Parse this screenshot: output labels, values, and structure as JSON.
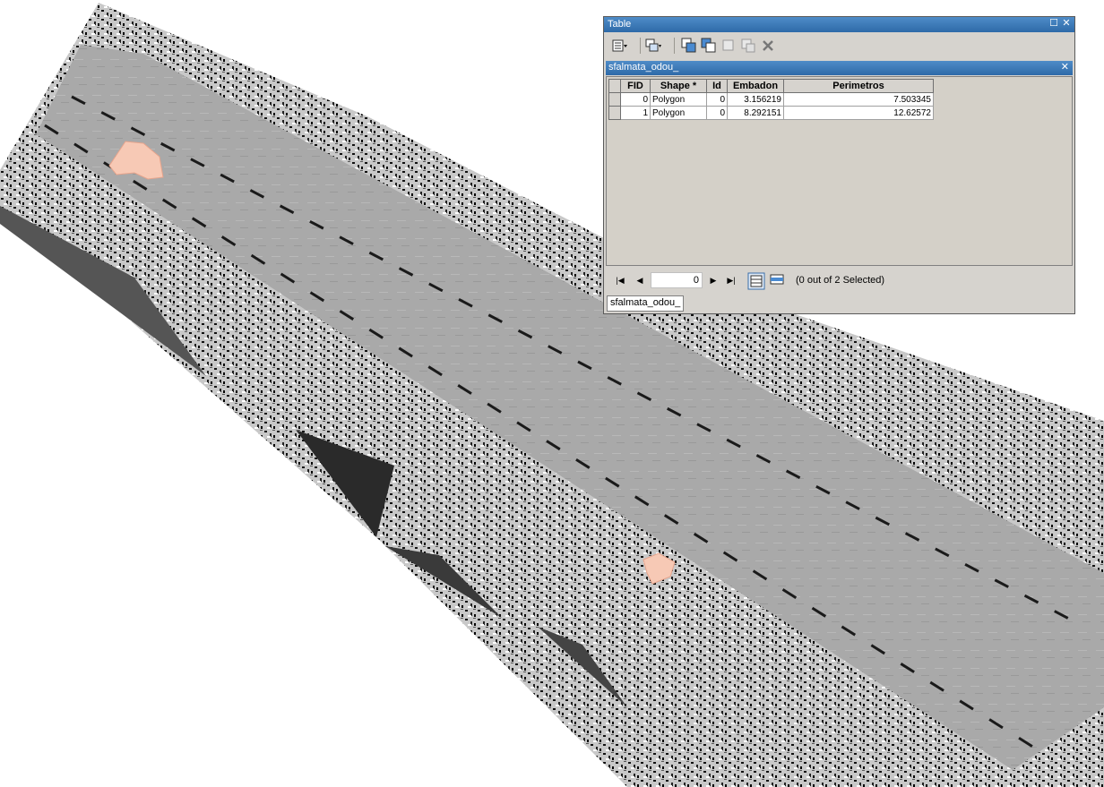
{
  "window": {
    "title": "Table",
    "maximize_icon": "maximize-icon",
    "close_icon": "close-icon"
  },
  "layer": {
    "name": "sfalmata_odou_",
    "tab_label": "sfalmata_odou_"
  },
  "table": {
    "columns": [
      "FID",
      "Shape *",
      "Id",
      "Embadon",
      "Perimetros"
    ],
    "rows": [
      [
        "0",
        "Polygon",
        "0",
        "3.156219",
        "7.503345"
      ],
      [
        "1",
        "Polygon",
        "0",
        "8.292151",
        "12.62572"
      ]
    ]
  },
  "navigation": {
    "current_record": "0",
    "selection_status": "(0 out of 2 Selected)"
  },
  "colors": {
    "polygon_fill": "#f7c9b5",
    "polygon_stroke": "#e7a48c",
    "titlebar": "#3a78b8"
  }
}
